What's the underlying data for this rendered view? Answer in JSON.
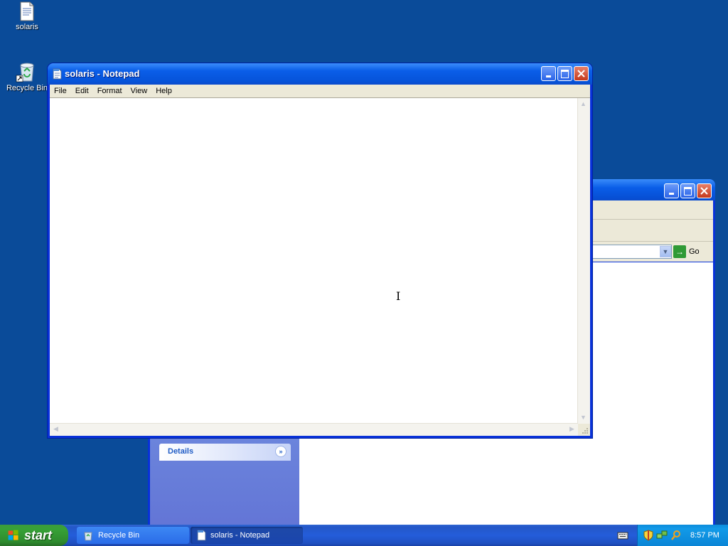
{
  "desktop": {
    "icons": [
      {
        "label": "solaris",
        "icon": "text-document-icon"
      },
      {
        "label": "Recycle Bin",
        "icon": "recycle-bin-icon"
      }
    ]
  },
  "background_window": {
    "address_go_label": "Go",
    "details_label": "Details"
  },
  "notepad": {
    "title": "solaris - Notepad",
    "menu": [
      "File",
      "Edit",
      "Format",
      "View",
      "Help"
    ],
    "content": ""
  },
  "taskbar": {
    "start_label": "start",
    "tasks": [
      {
        "label": "Recycle Bin",
        "icon": "recycle-bin-icon",
        "active": false
      },
      {
        "label": "solaris - Notepad",
        "icon": "notepad-icon",
        "active": true
      }
    ],
    "clock": "8:57 PM"
  },
  "colors": {
    "desktop": "#0a4b99",
    "title_bar": "#0a5ee8",
    "start_green": "#37a237",
    "tray": "#129ae8"
  }
}
